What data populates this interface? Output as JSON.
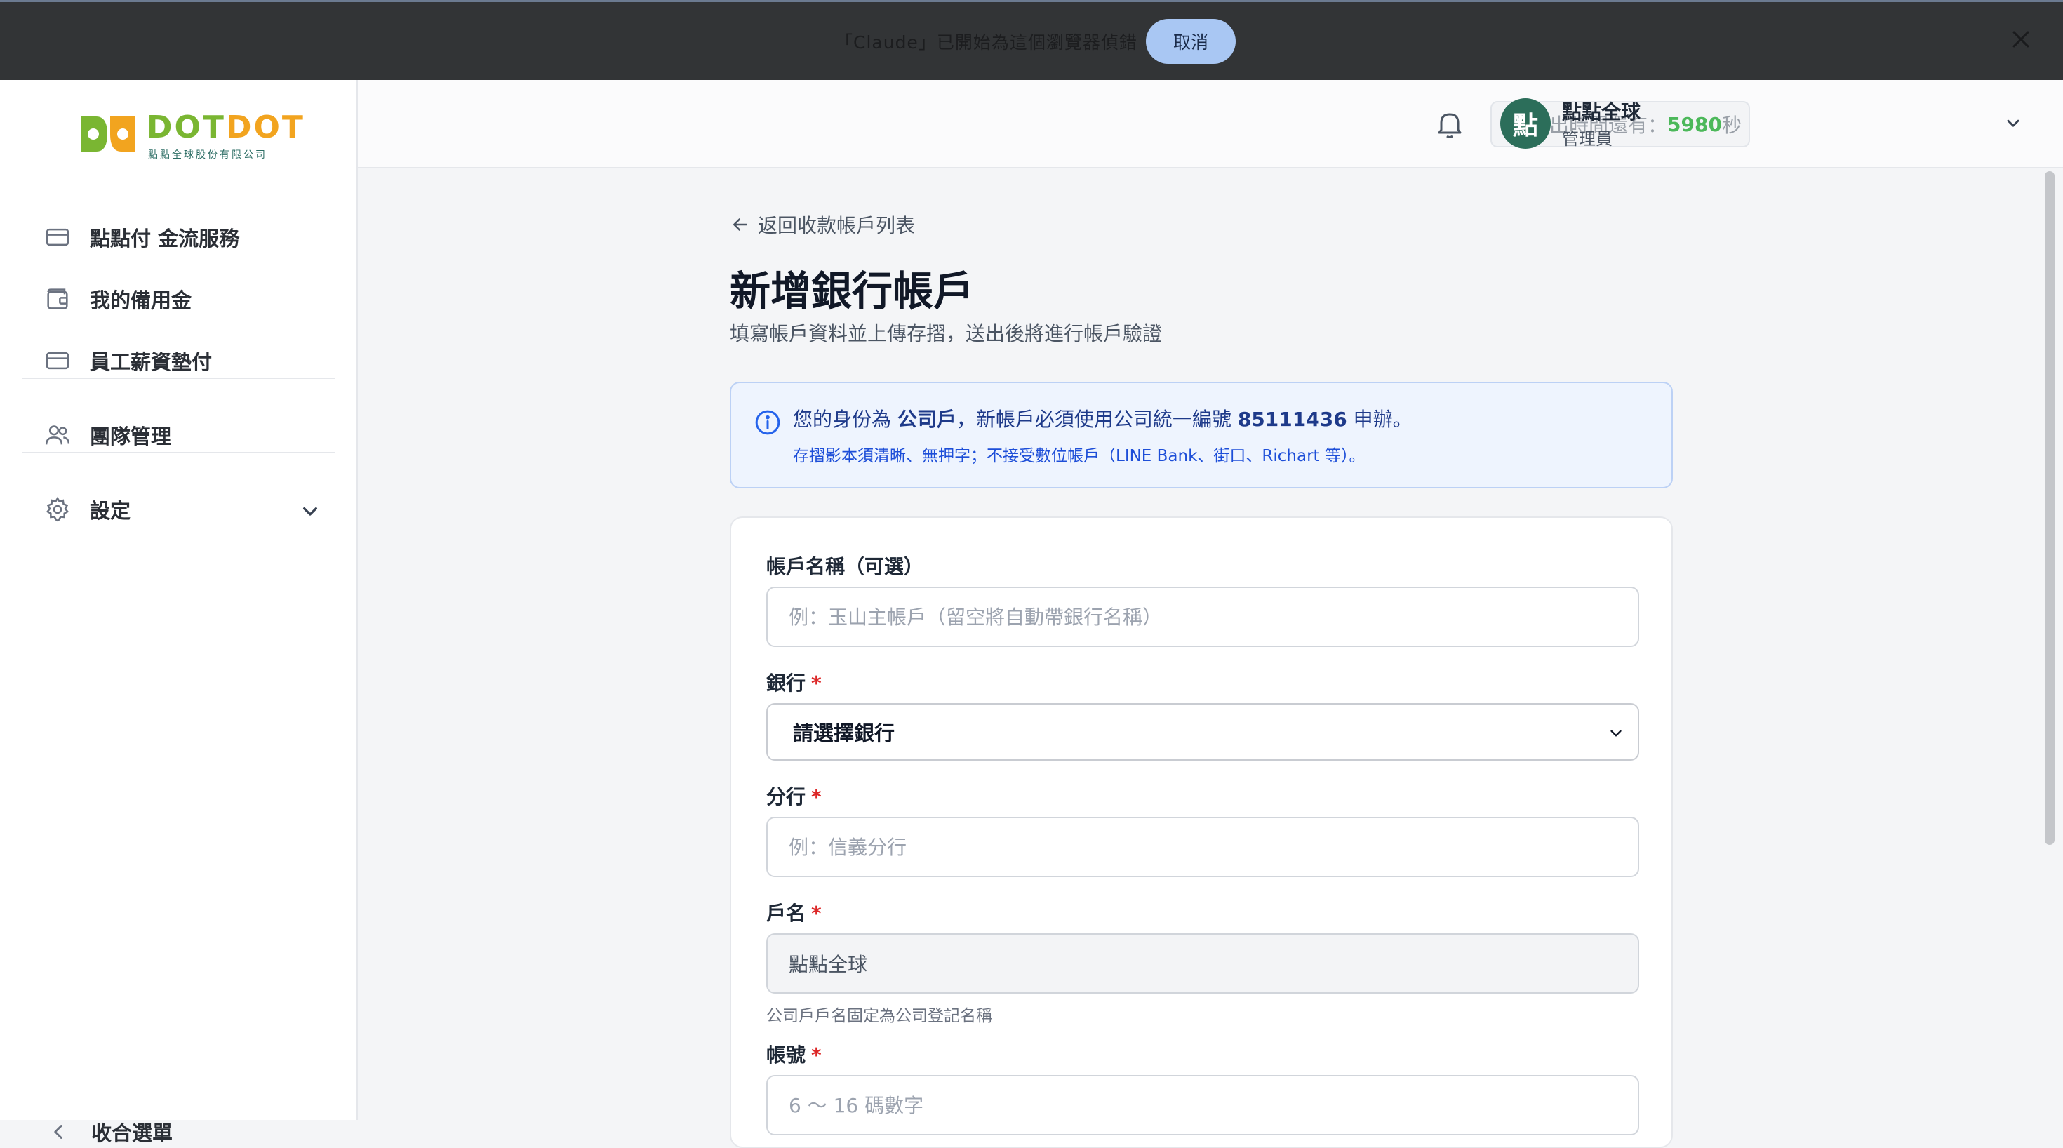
{
  "notification": {
    "message": "「Claude」已開始為這個瀏覽器偵錯",
    "cancel_label": "取消"
  },
  "brand": {
    "wordmark_a": "DOT",
    "wordmark_b": "DOT",
    "subtitle": "點點全球股份有限公司",
    "color_green": "#7ab632",
    "color_orange": "#f2a41f"
  },
  "sidebar": {
    "items": [
      {
        "label": "點點付 金流服務",
        "icon": "credit-card-icon"
      },
      {
        "label": "我的備用金",
        "icon": "wallet-icon"
      },
      {
        "label": "員工薪資墊付",
        "icon": "credit-card-icon"
      },
      {
        "label": "團隊管理",
        "icon": "users-icon"
      },
      {
        "label": "設定",
        "icon": "gear-icon"
      }
    ],
    "collapse_label": "收合選單"
  },
  "header": {
    "timer_prefix": "離登出時間還有：",
    "timer_value": "5980",
    "timer_unit": "秒",
    "user_initial": "點",
    "user_name": "點點全球",
    "user_role": "管理員"
  },
  "page": {
    "back_label": "返回收款帳戶列表",
    "title": "新增銀行帳戶",
    "subtitle": "填寫帳戶資料並上傳存摺，送出後將進行帳戶驗證"
  },
  "info": {
    "line1_a": "您的身份為 ",
    "line1_b": "公司戶",
    "line1_c": "，新帳戶必須使用公司統一編號 ",
    "line1_d": "85111436",
    "line1_e": " 申辦。",
    "line2": "存摺影本須清晰、無押字；不接受數位帳戶（LINE Bank、街口、Richart 等）。"
  },
  "form": {
    "account_name": {
      "label": "帳戶名稱（可選）",
      "placeholder": "例：玉山主帳戶（留空將自動帶銀行名稱）"
    },
    "bank": {
      "label": "銀行",
      "required": "*",
      "selected": "請選擇銀行"
    },
    "branch": {
      "label": "分行",
      "required": "*",
      "placeholder": "例：信義分行"
    },
    "holder": {
      "label": "戶名",
      "required": "*",
      "value": "點點全球",
      "help": "公司戶戶名固定為公司登記名稱"
    },
    "account_no": {
      "label": "帳號",
      "required": "*",
      "placeholder": "6 ～ 16 碼數字"
    }
  },
  "colors": {
    "accent_green": "#4cb85a",
    "avatar_bg": "#2c6e5a",
    "required_red": "#dc2626",
    "info_bg": "#eef4fe"
  }
}
